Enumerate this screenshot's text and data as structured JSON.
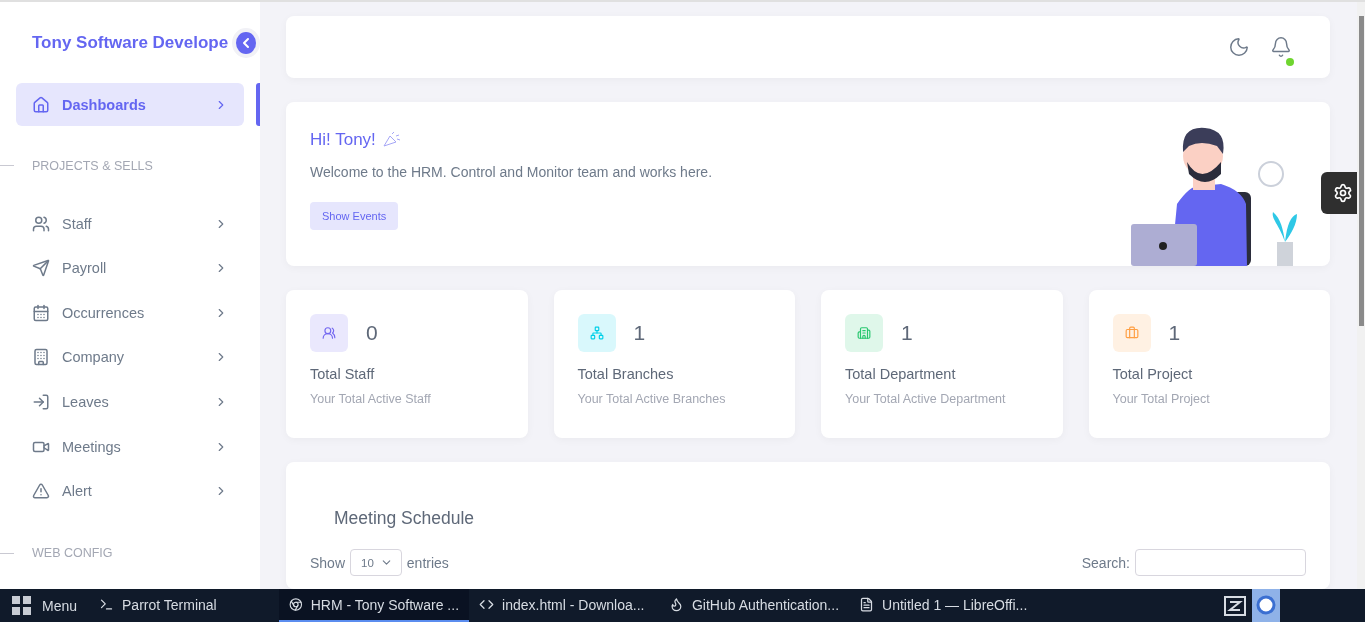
{
  "sidebar": {
    "brand": "Tony Software Develope",
    "items": [
      {
        "kind": "item",
        "label": "Dashboards",
        "selected": true
      },
      {
        "kind": "section",
        "label": "PROJECTS & SELLS"
      },
      {
        "kind": "item",
        "label": "Staff",
        "selected": false
      },
      {
        "kind": "item",
        "label": "Payroll",
        "selected": false
      },
      {
        "kind": "item",
        "label": "Occurrences",
        "selected": false
      },
      {
        "kind": "item",
        "label": "Company",
        "selected": false
      },
      {
        "kind": "item",
        "label": "Leaves",
        "selected": false
      },
      {
        "kind": "item",
        "label": "Meetings",
        "selected": false
      },
      {
        "kind": "item",
        "label": "Alert",
        "selected": false
      },
      {
        "kind": "section",
        "label": "WEB CONFIG"
      }
    ]
  },
  "topbar": {
    "online": true
  },
  "hero": {
    "title": "Hi! Tony!",
    "text": "Welcome to the HRM. Control and Monitor team and works here.",
    "button": "Show Events"
  },
  "stats": [
    {
      "value": "0",
      "title": "Total Staff",
      "subtitle": "Your Total Active Staff",
      "color": "#7367f0"
    },
    {
      "value": "1",
      "title": "Total Branches",
      "subtitle": "Your Total Active Branches",
      "color": "#00cfe8"
    },
    {
      "value": "1",
      "title": "Total Department",
      "subtitle": "Your Total Active Department",
      "color": "#28c76f"
    },
    {
      "value": "1",
      "title": "Total Project",
      "subtitle": "Your Total Project",
      "color": "#ff9f43"
    }
  ],
  "meeting": {
    "title": "Meeting Schedule",
    "show_label": "Show",
    "page_size": "10",
    "entries_label": "entries",
    "search_label": "Search:"
  },
  "taskbar": {
    "menu": "Menu",
    "apps": [
      {
        "label": "Parrot Terminal",
        "selected": false
      },
      {
        "label": "HRM - Tony Software ...",
        "selected": true
      },
      {
        "label": "index.html - Downloa...",
        "selected": false
      },
      {
        "label": "GitHub Authentication...",
        "selected": false
      },
      {
        "label": "Untitled 1 — LibreOffi...",
        "selected": false
      }
    ]
  }
}
